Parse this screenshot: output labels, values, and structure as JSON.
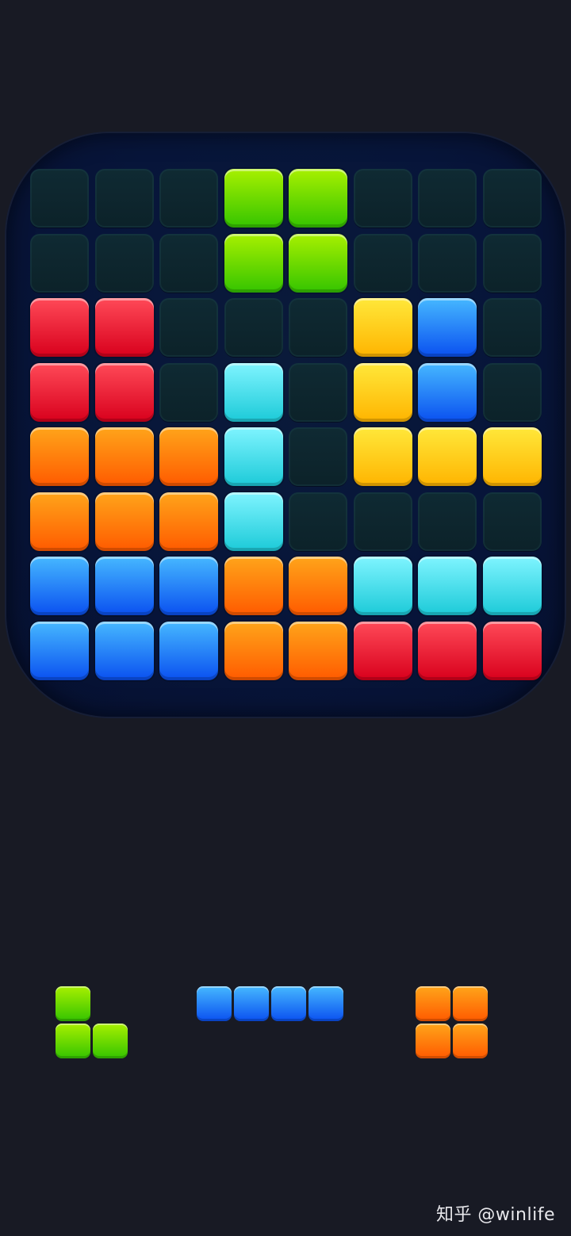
{
  "colors": {
    "empty": "#0e2730",
    "green": [
      "#a8f000",
      "#34c400"
    ],
    "red": [
      "#ff4a58",
      "#d8001c"
    ],
    "yellow": [
      "#ffe83a",
      "#ffb400"
    ],
    "blue": [
      "#46b8ff",
      "#0a50f0"
    ],
    "cyan": [
      "#7ff4ff",
      "#1ccad8"
    ],
    "orange": [
      "#ffa51a",
      "#ff5a00"
    ]
  },
  "board": {
    "rows": [
      [
        "empty",
        "empty",
        "empty",
        "green",
        "green",
        "empty",
        "empty",
        "empty"
      ],
      [
        "empty",
        "empty",
        "empty",
        "green",
        "green",
        "empty",
        "empty",
        "empty"
      ],
      [
        "red",
        "red",
        "empty",
        "empty",
        "empty",
        "yellow",
        "blue",
        "empty"
      ],
      [
        "red",
        "red",
        "empty",
        "cyan",
        "empty",
        "yellow",
        "blue",
        "empty"
      ],
      [
        "orange",
        "orange",
        "orange",
        "cyan",
        "empty",
        "yellow",
        "yellow",
        "yellow"
      ],
      [
        "orange",
        "orange",
        "orange",
        "cyan",
        "empty",
        "empty",
        "empty",
        "empty"
      ],
      [
        "blue",
        "blue",
        "blue",
        "orange",
        "orange",
        "cyan",
        "cyan",
        "cyan"
      ],
      [
        "blue",
        "blue",
        "blue",
        "orange",
        "orange",
        "red",
        "red",
        "red"
      ]
    ]
  },
  "tray": {
    "pieces": [
      {
        "name": "green-l-piece",
        "color": "green",
        "cells": [
          [
            0,
            0
          ],
          [
            1,
            0
          ],
          [
            1,
            1
          ]
        ]
      },
      {
        "name": "blue-i-piece",
        "color": "blue",
        "cells": [
          [
            0,
            0
          ],
          [
            0,
            1
          ],
          [
            0,
            2
          ],
          [
            0,
            3
          ]
        ]
      },
      {
        "name": "orange-square-piece",
        "color": "orange",
        "cells": [
          [
            0,
            0
          ],
          [
            0,
            1
          ],
          [
            1,
            0
          ],
          [
            1,
            1
          ]
        ]
      }
    ]
  },
  "watermark": {
    "text": "知乎 @winlife"
  }
}
